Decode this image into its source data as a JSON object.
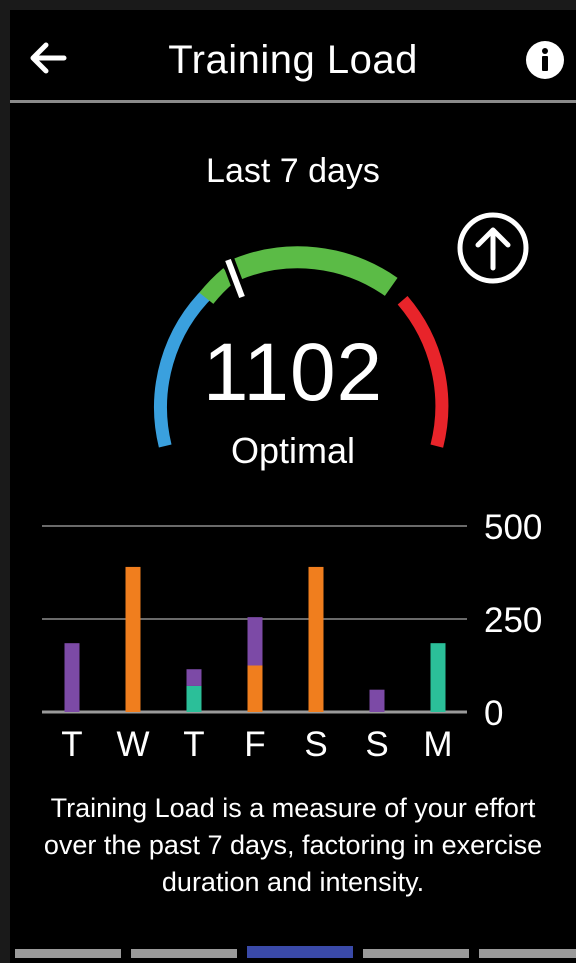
{
  "header": {
    "title": "Training Load",
    "back_icon": "back-arrow-icon",
    "info_icon": "info-icon"
  },
  "summary": {
    "period_label": "Last 7 days",
    "value": "1102",
    "status": "Optimal",
    "trend_icon": "arrow-up-circle-icon",
    "gauge_colors": {
      "low": "#3aa0de",
      "optimal": "#5bbb46",
      "high": "#e8242a"
    }
  },
  "chart_data": {
    "type": "bar",
    "stacked": true,
    "categories": [
      "T",
      "W",
      "T",
      "F",
      "S",
      "S",
      "M"
    ],
    "series": [
      {
        "color": "#2bbf99",
        "values": [
          0,
          0,
          70,
          0,
          0,
          0,
          0
        ]
      },
      {
        "color": "#f07e1e",
        "values": [
          0,
          390,
          0,
          125,
          390,
          0,
          0
        ]
      },
      {
        "color": "#7c4aa6",
        "values": [
          185,
          0,
          45,
          130,
          0,
          60,
          0
        ]
      },
      {
        "color": "#2bbf99",
        "values": [
          0,
          0,
          0,
          0,
          0,
          0,
          185
        ]
      }
    ],
    "y_ticks": [
      "0",
      "250",
      "500"
    ],
    "ylim": [
      0,
      500
    ],
    "grid": true
  },
  "description": "Training Load is a measure of your effort over the past 7 days, factoring in exercise duration and intensity.",
  "pager": {
    "count": 5,
    "active_index": 2,
    "active_color": "#3a4aa8",
    "inactive_color": "#9a9a9a"
  }
}
